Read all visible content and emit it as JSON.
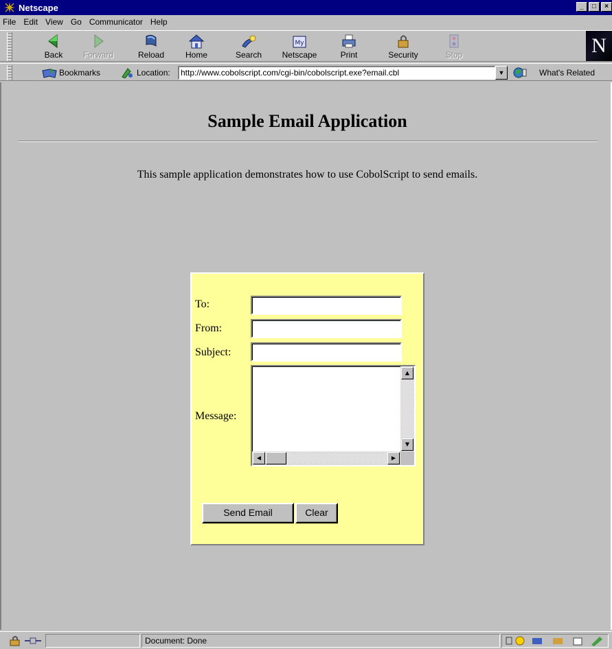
{
  "window": {
    "title": "Netscape"
  },
  "menu": [
    "File",
    "Edit",
    "View",
    "Go",
    "Communicator",
    "Help"
  ],
  "toolbar": {
    "buttons": [
      {
        "label": "Back",
        "icon": "back-arrow-icon",
        "enabled": true
      },
      {
        "label": "Forward",
        "icon": "forward-arrow-icon",
        "enabled": false
      },
      {
        "label": "Reload",
        "icon": "reload-icon",
        "enabled": true
      },
      {
        "label": "Home",
        "icon": "home-icon",
        "enabled": true
      },
      {
        "label": "Search",
        "icon": "search-icon",
        "enabled": true
      },
      {
        "label": "Netscape",
        "icon": "my-netscape-icon",
        "enabled": true
      },
      {
        "label": "Print",
        "icon": "printer-icon",
        "enabled": true
      },
      {
        "label": "Security",
        "icon": "padlock-icon",
        "enabled": true
      },
      {
        "label": "Stop",
        "icon": "stop-icon",
        "enabled": false
      }
    ],
    "logo_text": "N"
  },
  "location": {
    "bookmarks_label": "Bookmarks",
    "location_label": "Location:",
    "url": "http://www.cobolscript.com/cgi-bin/cobolscript.exe?email.cbl",
    "whats_related_label": "What's Related"
  },
  "page": {
    "title": "Sample Email Application",
    "intro": "This sample application demonstrates how to use CobolScript to send emails.",
    "form": {
      "to_label": "To:",
      "from_label": "From:",
      "subject_label": "Subject:",
      "message_label": "Message:",
      "to_value": "",
      "from_value": "",
      "subject_value": "",
      "message_value": "",
      "send_label": "Send Email",
      "clear_label": "Clear",
      "background": "#ffff99"
    }
  },
  "status": {
    "text": "Document: Done"
  },
  "colors": {
    "titlebar": "#000080",
    "chrome": "#c0c0c0"
  }
}
